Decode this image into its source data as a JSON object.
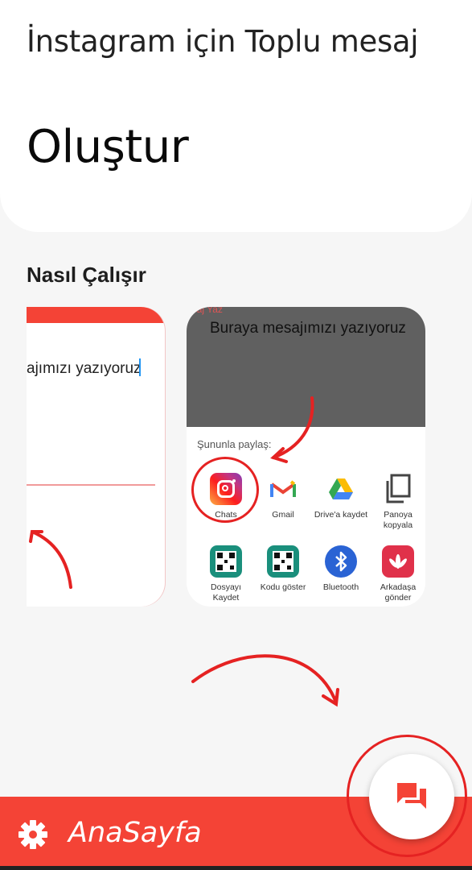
{
  "header": {
    "app_title": "İnstagram için Toplu mesaj",
    "headline": "Oluştur"
  },
  "how_it_works": {
    "title": "Nasıl Çalışır",
    "left_card": {
      "typed_text": "ajımızı yazıyoruz"
    },
    "right_card": {
      "mini_label": "esaj Yaz",
      "message_text": "Buraya mesajımızı yazıyoruz",
      "share_label": "Şununla paylaş:",
      "apps": [
        {
          "name": "Chats",
          "icon": "instagram-icon"
        },
        {
          "name": "Gmail",
          "icon": "gmail-icon"
        },
        {
          "name": "Drive'a kaydet",
          "icon": "google-drive-icon"
        },
        {
          "name": "Panoya kopyala",
          "icon": "copy-icon"
        },
        {
          "name": "Dosyayı Kaydet",
          "icon": "qr-code-icon"
        },
        {
          "name": "Kodu göster",
          "icon": "qr-code-icon"
        },
        {
          "name": "Bluetooth",
          "icon": "bluetooth-icon"
        },
        {
          "name": "Arkadaşa gönder",
          "icon": "huawei-icon"
        }
      ]
    }
  },
  "bottom_nav": {
    "label": "AnaSayfa",
    "icon": "gear-icon"
  },
  "fab": {
    "icon": "chat-bubbles-icon"
  },
  "colors": {
    "accent": "#f44336",
    "annotation": "#e52222",
    "background": "#f6f6f6"
  }
}
